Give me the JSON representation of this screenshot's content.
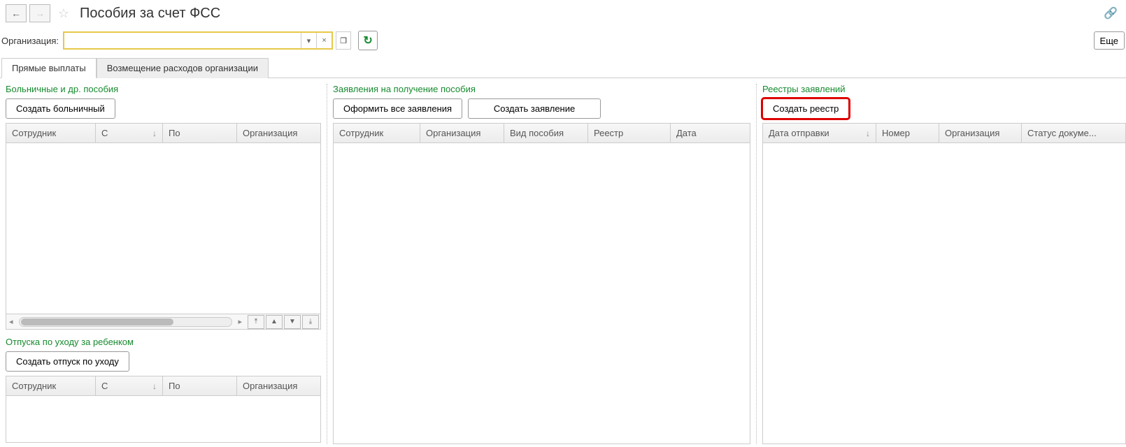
{
  "header": {
    "title": "Пособия за счет ФСС"
  },
  "filter": {
    "org_label": "Организация:",
    "more_label": "Еще"
  },
  "tabs": {
    "direct": "Прямые выплаты",
    "reimb": "Возмещение расходов организации"
  },
  "left": {
    "section1_title": "Больничные и др. пособия",
    "create_sickleave": "Создать больничный",
    "section2_title": "Отпуска по уходу за ребенком",
    "create_leave": "Создать отпуск по уходу",
    "cols": {
      "employee": "Сотрудник",
      "from": "С",
      "to": "По",
      "org": "Организация"
    }
  },
  "mid": {
    "title": "Заявления на получение пособия",
    "create_all": "Оформить все заявления",
    "create_one": "Создать заявление",
    "cols": {
      "employee": "Сотрудник",
      "org": "Организация",
      "kind": "Вид пособия",
      "reestr": "Реестр",
      "date": "Дата"
    }
  },
  "right": {
    "title": "Реестры заявлений",
    "create": "Создать реестр",
    "cols": {
      "send_date": "Дата отправки",
      "number": "Номер",
      "org": "Организация",
      "status": "Статус докуме..."
    }
  }
}
